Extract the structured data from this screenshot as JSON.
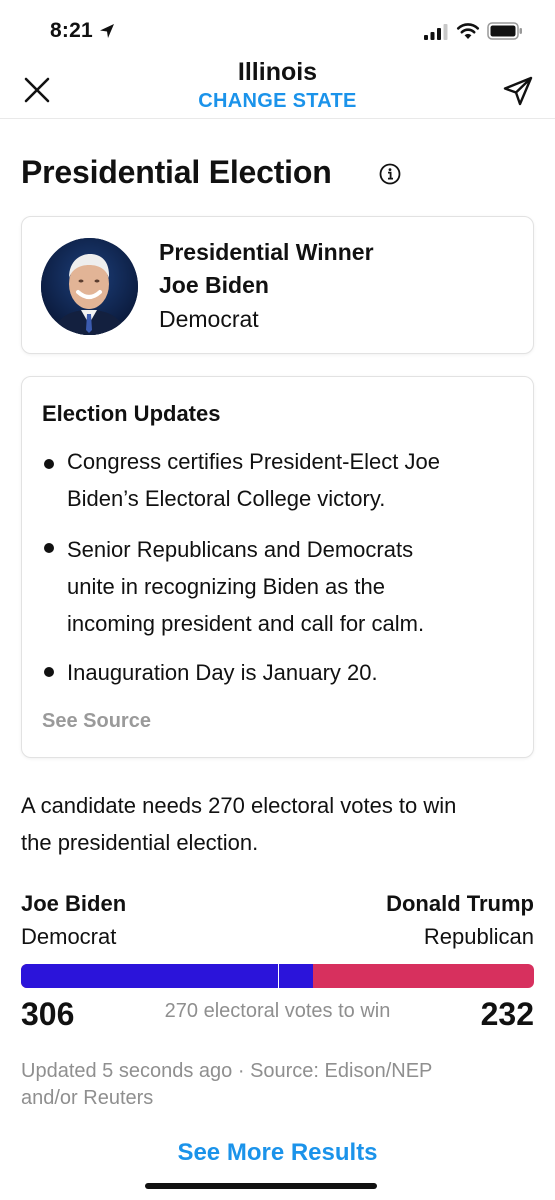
{
  "status_bar": {
    "time": "8:21"
  },
  "header": {
    "title": "Illinois",
    "change_state": "CHANGE STATE"
  },
  "section": {
    "title": "Presidential Election"
  },
  "winner": {
    "heading": "Presidential Winner",
    "name": "Joe Biden",
    "party": "Democrat"
  },
  "updates": {
    "title": "Election Updates",
    "items": [
      {
        "line1": "Congress certifies President-Elect Joe",
        "line2": "Biden’s Electoral College victory."
      },
      {
        "line1": "Senior Republicans and Democrats",
        "line2": "unite in recognizing Biden as the",
        "line3": "incoming president and call for calm."
      },
      {
        "line1": "Inauguration Day is January 20."
      }
    ],
    "see_source": "See Source"
  },
  "needs": {
    "line1": "A candidate needs 270 electoral votes to win",
    "line2": "the presidential election."
  },
  "results": {
    "left": {
      "name": "Joe Biden",
      "party": "Democrat",
      "votes": "306"
    },
    "right": {
      "name": "Donald Trump",
      "party": "Republican",
      "votes": "232"
    },
    "to_win": "270 electoral votes to win",
    "biden_fraction": 0.5688,
    "threshold_fraction": 0.5019
  },
  "footer": {
    "updated": "Updated 5 seconds ago",
    "source": "Source: Edison/NEP",
    "source2": "and/or Reuters",
    "see_more": "See More Results"
  },
  "colors": {
    "accent": "#1b93ea",
    "democrat": "#2b14da",
    "republican": "#d7305e",
    "muted": "#8f8f8f"
  },
  "icons": [
    "location-arrow-icon",
    "signal-icon",
    "wifi-icon",
    "battery-icon",
    "close-icon",
    "share-icon",
    "info-icon"
  ]
}
